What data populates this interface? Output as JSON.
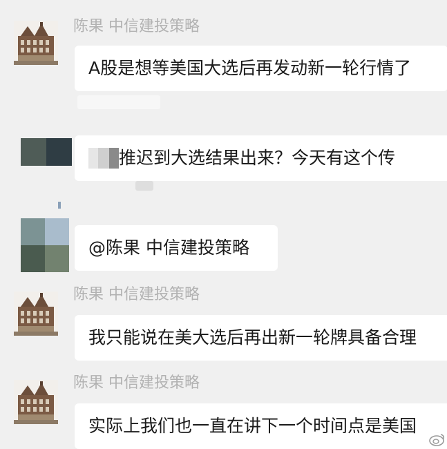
{
  "messages": [
    {
      "sender": "陈果 中信建投策略",
      "text": "A股是想等美国大选后再发动新一轮行情了"
    },
    {
      "sender": "",
      "text": "推迟到大选结果出来？今天有这个传"
    },
    {
      "sender": "",
      "text": "@陈果 中信建投策略"
    },
    {
      "sender": "陈果 中信建投策略",
      "text": "我只能说在美大选后再出新一轮牌具备合理"
    },
    {
      "sender": "陈果 中信建投策略",
      "text": "实际上我们也一直在讲下一个时间点是美国"
    }
  ]
}
